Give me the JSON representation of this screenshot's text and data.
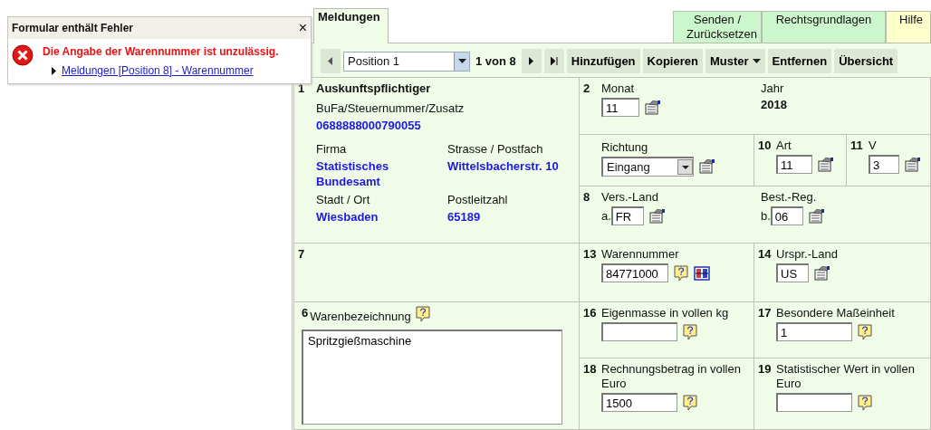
{
  "error_popup": {
    "title": "Formular enthält Fehler",
    "close": "×",
    "message": "Die Angabe der Warennummer ist unzulässig.",
    "link": "Meldungen [Position 8] - Warennummer"
  },
  "tabs": [
    {
      "label": "Meldungen",
      "selected": true,
      "color": "#f0fbe8"
    },
    {
      "label": "Senden / Zurücksetzen",
      "selected": false,
      "color": "#ccf7cc"
    },
    {
      "label": "Rechtsgrundlagen",
      "selected": false,
      "color": "#ccf7cc"
    },
    {
      "label": "Hilfe",
      "selected": false,
      "color": "#ffffcc"
    }
  ],
  "toolbar": {
    "position_select": "Position 1",
    "counter": "1 von 8",
    "buttons": [
      {
        "label": "Hinzufügen",
        "kind": "plain"
      },
      {
        "label": "Kopieren",
        "kind": "plain"
      },
      {
        "label": "Muster",
        "kind": "menu"
      },
      {
        "label": "Entfernen",
        "kind": "plain"
      },
      {
        "label": "Übersicht",
        "kind": "plain"
      }
    ]
  },
  "reporter": {
    "number": "1",
    "title": "Auskunftspflichtiger",
    "id_label": "BuFa/Steuernummer/Zusatz",
    "id_value": "0688888000790055",
    "fields": [
      {
        "label": "Firma",
        "value": "Statistisches Bundesamt"
      },
      {
        "label": "Strasse / Postfach",
        "value": "Wittelsbacherstr. 10"
      },
      {
        "label": "Stadt / Ort",
        "value": "Wiesbaden"
      },
      {
        "label": "Postleitzahl",
        "value": "65189"
      }
    ]
  },
  "period": {
    "number": "2",
    "month": {
      "label": "Monat",
      "value": "11",
      "properties_button": true
    },
    "year": {
      "label": "Jahr",
      "value": "2018"
    }
  },
  "direction": {
    "label": "Richtung",
    "value": "Eingang",
    "properties_button": true
  },
  "art": {
    "number": "10",
    "label": "Art",
    "value": "11",
    "properties_button": true
  },
  "v": {
    "number": "11",
    "label": "V",
    "value": "3",
    "properties_button": true
  },
  "countries": {
    "number": "8",
    "fields": [
      {
        "label": "Vers.-Land",
        "prefix": "a.",
        "value": "FR",
        "properties_button": true
      },
      {
        "label": "Best.-Reg.",
        "prefix": "b.",
        "value": "06",
        "properties_button": true
      }
    ]
  },
  "box_7": {
    "number": "7"
  },
  "commodity_code": {
    "number": "13",
    "label": "Warennummer",
    "value": "84771000",
    "help_button": true,
    "compare_button": true
  },
  "origin": {
    "number": "14",
    "label": "Urspr.-Land",
    "value": "US",
    "properties_button": true
  },
  "description": {
    "number": "6",
    "label": "Warenbezeichnung",
    "value": "Spritzgießmaschine",
    "help_button": true
  },
  "mass": {
    "number": "16",
    "label": "Eigenmasse in vollen kg",
    "help_button": true
  },
  "unit": {
    "number": "17",
    "label": "Besondere Maßeinheit",
    "value": "1",
    "help_button": true
  },
  "invoice": {
    "number": "18",
    "label": "Rechnungsbetrag in vollen Euro",
    "value": "1500",
    "help_button": true
  },
  "stat_value": {
    "number": "19",
    "label": "Statistischer Wert in vollen Euro",
    "help_button": true
  }
}
